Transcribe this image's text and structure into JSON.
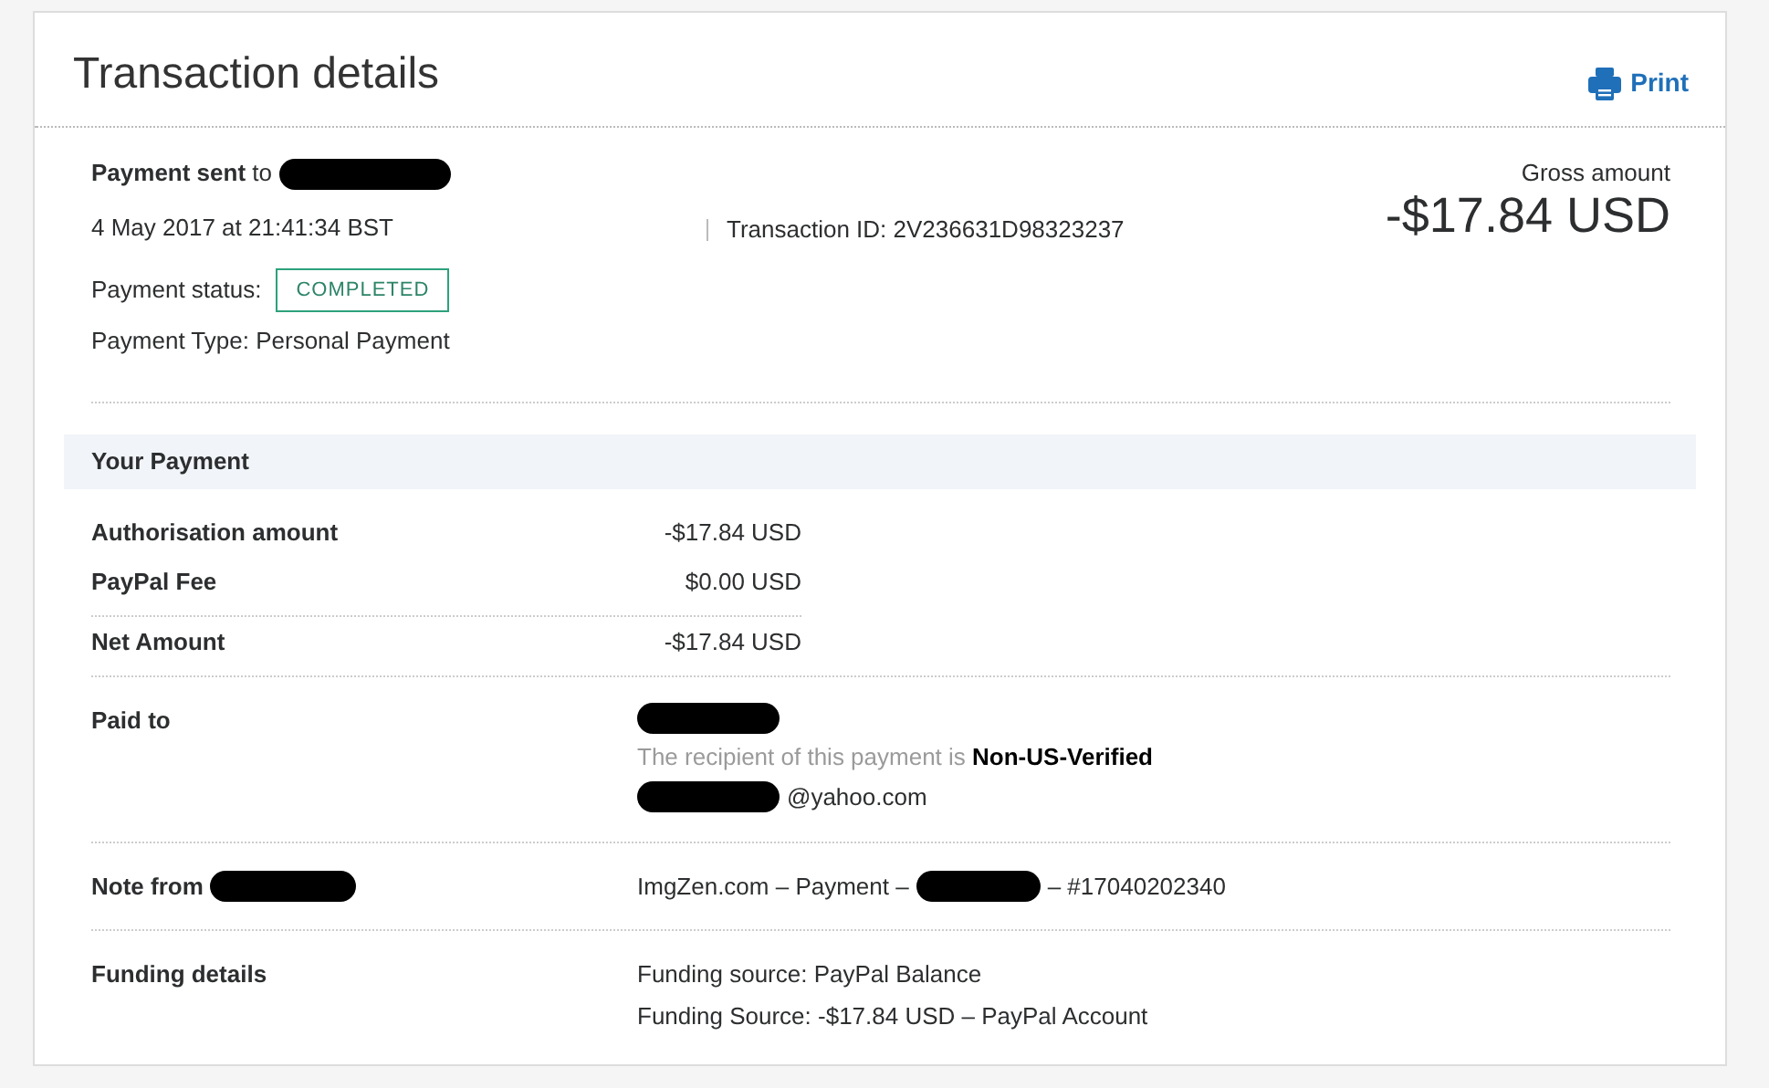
{
  "header": {
    "title": "Transaction details",
    "print_label": "Print"
  },
  "summary": {
    "sent_to": [
      {
        "kind": "text",
        "text": "**Payment sent** to"
      },
      {
        "kind": "redaction"
      }
    ],
    "date": "4 May 2017 at 21:41:34 BST",
    "transaction_id": "Transaction ID: 2V236631D98323237",
    "status_label": "Payment status:",
    "status": "COMPLETED",
    "payment_type": "Payment Type: Personal Payment",
    "gross_label": "Gross amount",
    "gross_amount": "-$17.84 USD"
  },
  "your_payment": {
    "heading": "Your Payment",
    "rows": [
      {
        "label": "Authorisation amount",
        "value": "-$17.84 USD"
      },
      {
        "label": "PayPal Fee",
        "value": "$0.00 USD"
      },
      {
        "label": "Net Amount",
        "value": "-$17.84 USD"
      }
    ]
  },
  "details": [
    {
      "label": [
        {
          "kind": "text",
          "text": "Paid to"
        }
      ],
      "lines": [
        [
          {
            "kind": "redaction"
          }
        ],
        [
          {
            "kind": "note",
            "text": "The recipient of this payment is **Non-US-Verified**"
          }
        ],
        [
          {
            "kind": "redaction"
          },
          {
            "kind": "text",
            "text": "@yahoo.com"
          }
        ]
      ]
    },
    {
      "label": [
        {
          "kind": "text",
          "text": "Note from"
        },
        {
          "kind": "redaction"
        }
      ],
      "lines": [
        [
          {
            "kind": "text",
            "text": "ImgZen.com – Payment –"
          },
          {
            "kind": "redaction"
          },
          {
            "kind": "text",
            "text": "– #17040202340"
          }
        ]
      ]
    },
    {
      "label": [
        {
          "kind": "text",
          "text": "Funding details"
        }
      ],
      "lines": [
        [
          {
            "kind": "text",
            "text": "Funding source: PayPal Balance"
          }
        ],
        [
          {
            "kind": "text",
            "text": "Funding Source: -$17.84 USD – PayPal Account"
          }
        ]
      ]
    }
  ]
}
